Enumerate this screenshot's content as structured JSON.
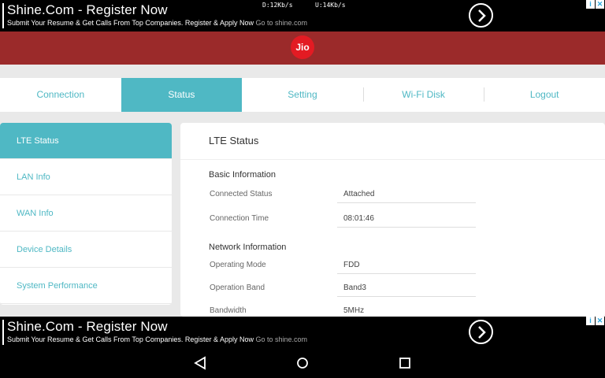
{
  "ad_top": {
    "title": "Shine.Com - Register Now",
    "subtitle": "Submit Your Resume & Get Calls From Top Companies. Register & Apply Now",
    "domain": "Go to shine.com"
  },
  "status_bar": {
    "download": "D:12Kb/s",
    "upload": "U:14Kb/s"
  },
  "ad_bottom": {
    "title": "Shine.Com - Register Now",
    "subtitle": "Submit Your Resume & Get Calls From Top Companies. Register & Apply Now",
    "domain": "Go to shine.com"
  },
  "brand": {
    "logo_text": "Jio",
    "header_color": "#9b2a2a",
    "accent": "#4fb8c4"
  },
  "tabs": [
    {
      "label": "Connection"
    },
    {
      "label": "Status"
    },
    {
      "label": "Setting"
    },
    {
      "label": "Wi-Fi Disk"
    },
    {
      "label": "Logout"
    }
  ],
  "sidebar": [
    {
      "label": "LTE Status"
    },
    {
      "label": "LAN Info"
    },
    {
      "label": "WAN Info"
    },
    {
      "label": "Device Details"
    },
    {
      "label": "System Performance"
    }
  ],
  "main": {
    "title": "LTE Status",
    "sections": [
      {
        "title": "Basic Information",
        "rows": [
          {
            "label": "Connected Status",
            "value": "Attached"
          },
          {
            "label": "Connection Time",
            "value": "08:01:46"
          }
        ]
      },
      {
        "title": "Network Information",
        "rows": [
          {
            "label": "Operating Mode",
            "value": "FDD"
          },
          {
            "label": "Operation Band",
            "value": "Band3"
          },
          {
            "label": "Bandwidth",
            "value": "5MHz"
          }
        ]
      }
    ]
  },
  "icons": {
    "ad_arrow": "chevron-right-icon",
    "nav_back": "back-triangle-icon",
    "nav_home": "home-circle-icon",
    "nav_recents": "recents-square-icon"
  }
}
